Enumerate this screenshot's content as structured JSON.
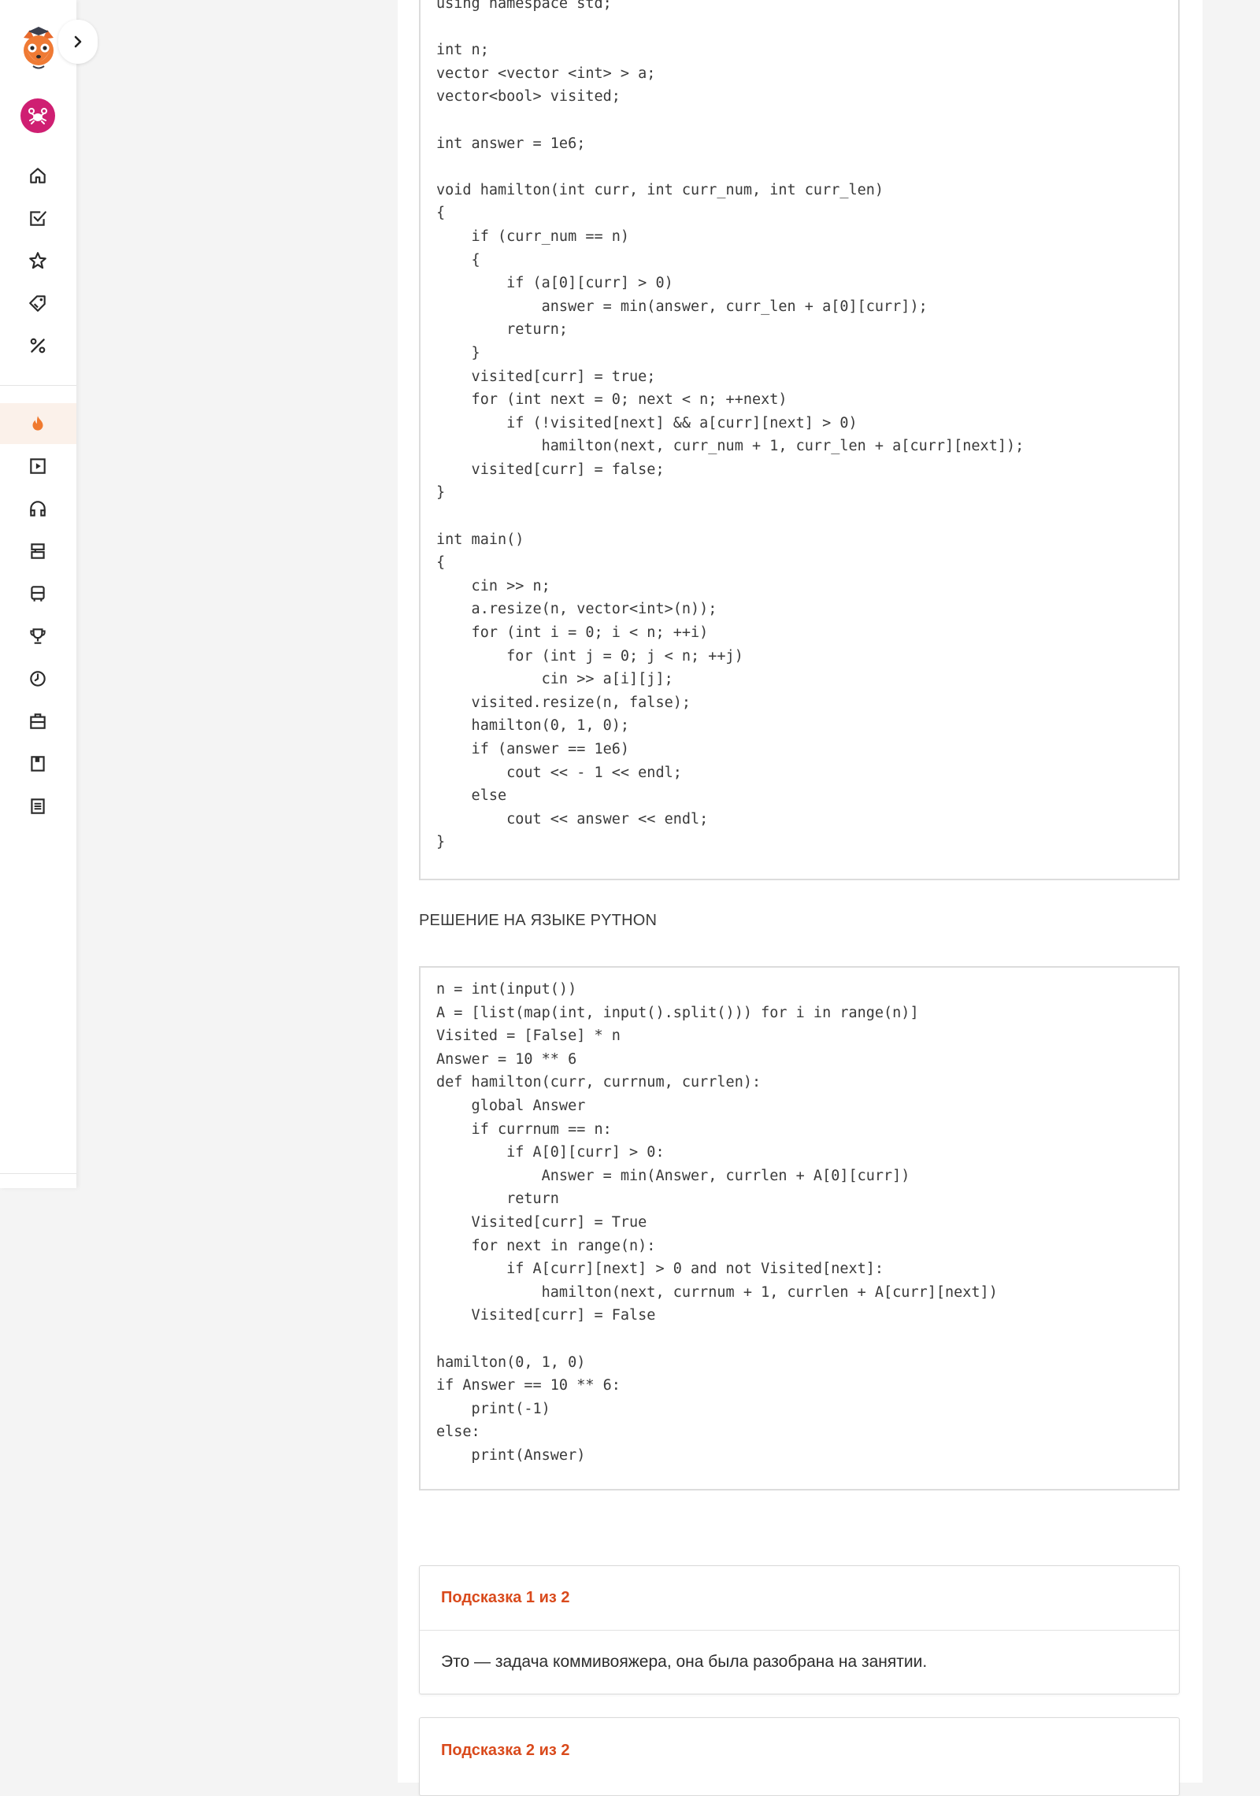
{
  "sidebar": {
    "expand_icon": "chevron-right-icon",
    "top_icons": [
      "home-icon",
      "tasks-checkbox-icon",
      "star-icon",
      "tag-icon",
      "percent-icon"
    ],
    "bottom_icons": [
      "fire-icon",
      "play-icon",
      "headphones-icon",
      "stack-icon",
      "bus-icon",
      "trophy-icon",
      "clock-icon",
      "briefcase-icon",
      "notebook-icon",
      "document-list-icon"
    ],
    "accent_color": "#cf1f72",
    "active_color": "#f07a2f"
  },
  "cpp_solution": {
    "code": "using namespace std;\n\nint n;\nvector <vector <int> > a;\nvector<bool> visited;\n\nint answer = 1e6;\n\nvoid hamilton(int curr, int curr_num, int curr_len)\n{\n    if (curr_num == n)\n    {\n        if (a[0][curr] > 0)\n            answer = min(answer, curr_len + a[0][curr]);\n        return;\n    }\n    visited[curr] = true;\n    for (int next = 0; next < n; ++next)\n        if (!visited[next] && a[curr][next] > 0)\n            hamilton(next, curr_num + 1, curr_len + a[curr][next]);\n    visited[curr] = false;\n}\n\nint main()\n{\n    cin >> n;\n    a.resize(n, vector<int>(n));\n    for (int i = 0; i < n; ++i)\n        for (int j = 0; j < n; ++j)\n            cin >> a[i][j];\n    visited.resize(n, false);\n    hamilton(0, 1, 0);\n    if (answer == 1e6)\n        cout << - 1 << endl;\n    else\n        cout << answer << endl;\n}"
  },
  "python_section_title": "РЕШЕНИЕ НА ЯЗЫКЕ PYTHON",
  "python_solution": {
    "code": "n = int(input())\nA = [list(map(int, input().split())) for i in range(n)]\nVisited = [False] * n\nAnswer = 10 ** 6\ndef hamilton(curr, currnum, currlen):\n    global Answer\n    if currnum == n:\n        if A[0][curr] > 0:\n            Answer = min(Answer, currlen + A[0][curr])\n        return\n    Visited[curr] = True\n    for next in range(n):\n        if A[curr][next] > 0 and not Visited[next]:\n            hamilton(next, currnum + 1, currlen + A[curr][next])\n    Visited[curr] = False\n\nhamilton(0, 1, 0)\nif Answer == 10 ** 6:\n    print(-1)\nelse:\n    print(Answer)"
  },
  "hints": [
    {
      "title": "Подсказка 1 из 2",
      "text": "Это — задача коммивояжера, она была разобрана на занятии."
    },
    {
      "title": "Подсказка 2 из 2",
      "text": ""
    }
  ]
}
